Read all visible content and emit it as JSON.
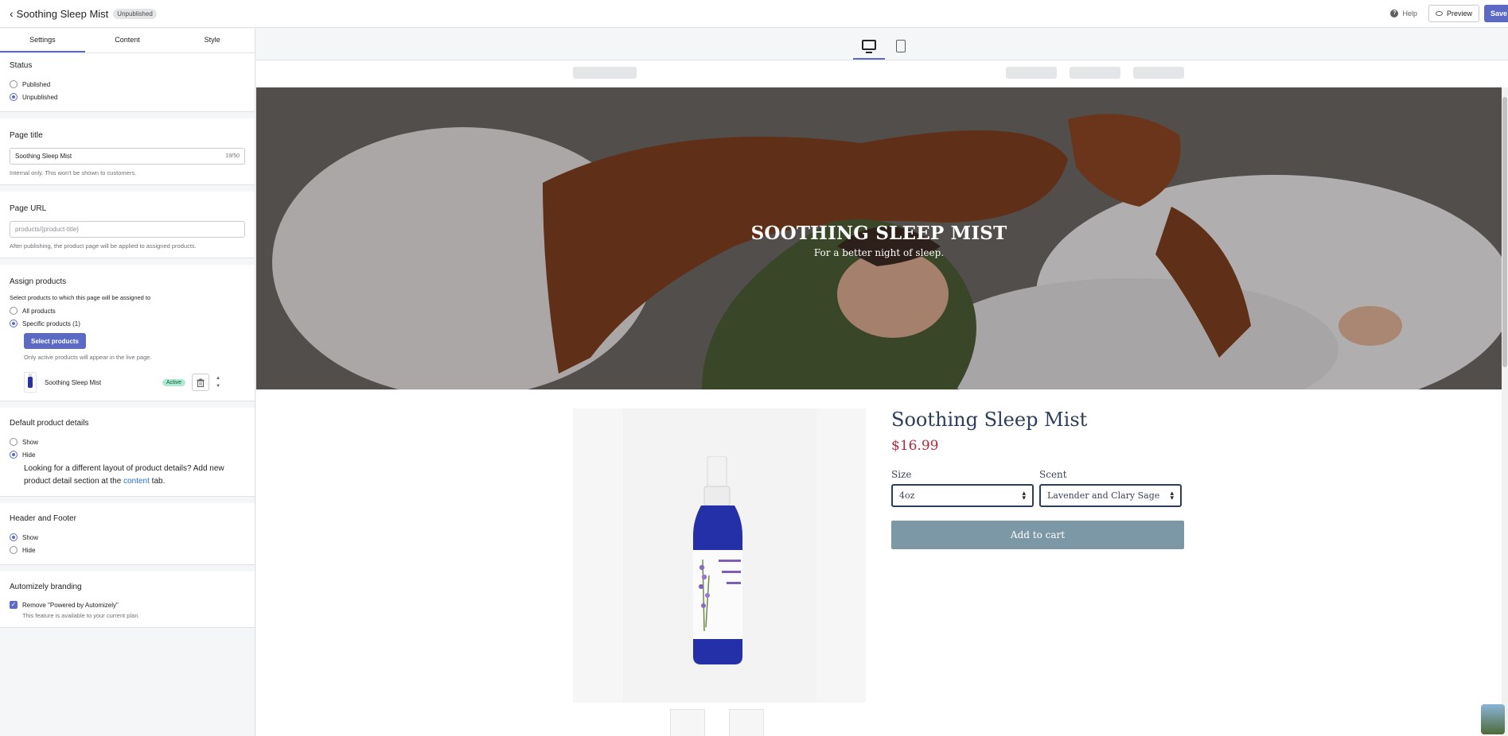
{
  "topbar": {
    "back_chevron": "‹",
    "page_name": "Soothing Sleep Mist",
    "status_badge": "Unpublished",
    "help_label": "Help",
    "preview_label": "Preview",
    "save_label": "Save"
  },
  "tabs": [
    "Settings",
    "Content",
    "Style"
  ],
  "status": {
    "title": "Status",
    "options": [
      "Published",
      "Unpublished"
    ],
    "selected": "Unpublished"
  },
  "page_title": {
    "title": "Page title",
    "value": "Soothing Sleep Mist",
    "count": "19/50",
    "help": "Internal only. This won't be shown to customers."
  },
  "page_url": {
    "title": "Page URL",
    "placeholder": "products/{product-title}",
    "help": "After publishing, the product page will be applied to assigned products."
  },
  "assign": {
    "title": "Assign products",
    "desc": "Select products to which this page will be assigned to",
    "options": [
      "All products",
      "Specific products (1)"
    ],
    "selected": "Specific products (1)",
    "button": "Select products",
    "note": "Only active products will appear in the live page.",
    "product_name": "Soothing Sleep Mist",
    "product_status": "Active"
  },
  "default_details": {
    "title": "Default product details",
    "options": [
      "Show",
      "Hide"
    ],
    "selected": "Hide",
    "note_before": "Looking for a different layout of product details? Add new product detail section at the ",
    "note_link": "content",
    "note_after": " tab."
  },
  "header_footer": {
    "title": "Header and Footer",
    "options": [
      "Show",
      "Hide"
    ],
    "selected": "Show"
  },
  "branding": {
    "title": "Automizely branding",
    "checkbox_label": "Remove \"Powered by Automizely\"",
    "checked": true,
    "help": "This feature is available to your current plan."
  },
  "preview": {
    "hero_title": "SOOTHING SLEEP MIST",
    "hero_subtitle": "For a better night of sleep.",
    "product_title": "Soothing Sleep Mist",
    "price": "$16.99",
    "size_label": "Size",
    "size_value": "4oz",
    "scent_label": "Scent",
    "scent_value": "Lavender and Clary Sage",
    "add_to_cart": "Add to cart"
  },
  "colors": {
    "accent": "#5c6ac4",
    "price": "#b5283c",
    "title": "#2c3e5c",
    "cart_button": "#7c98a6"
  }
}
